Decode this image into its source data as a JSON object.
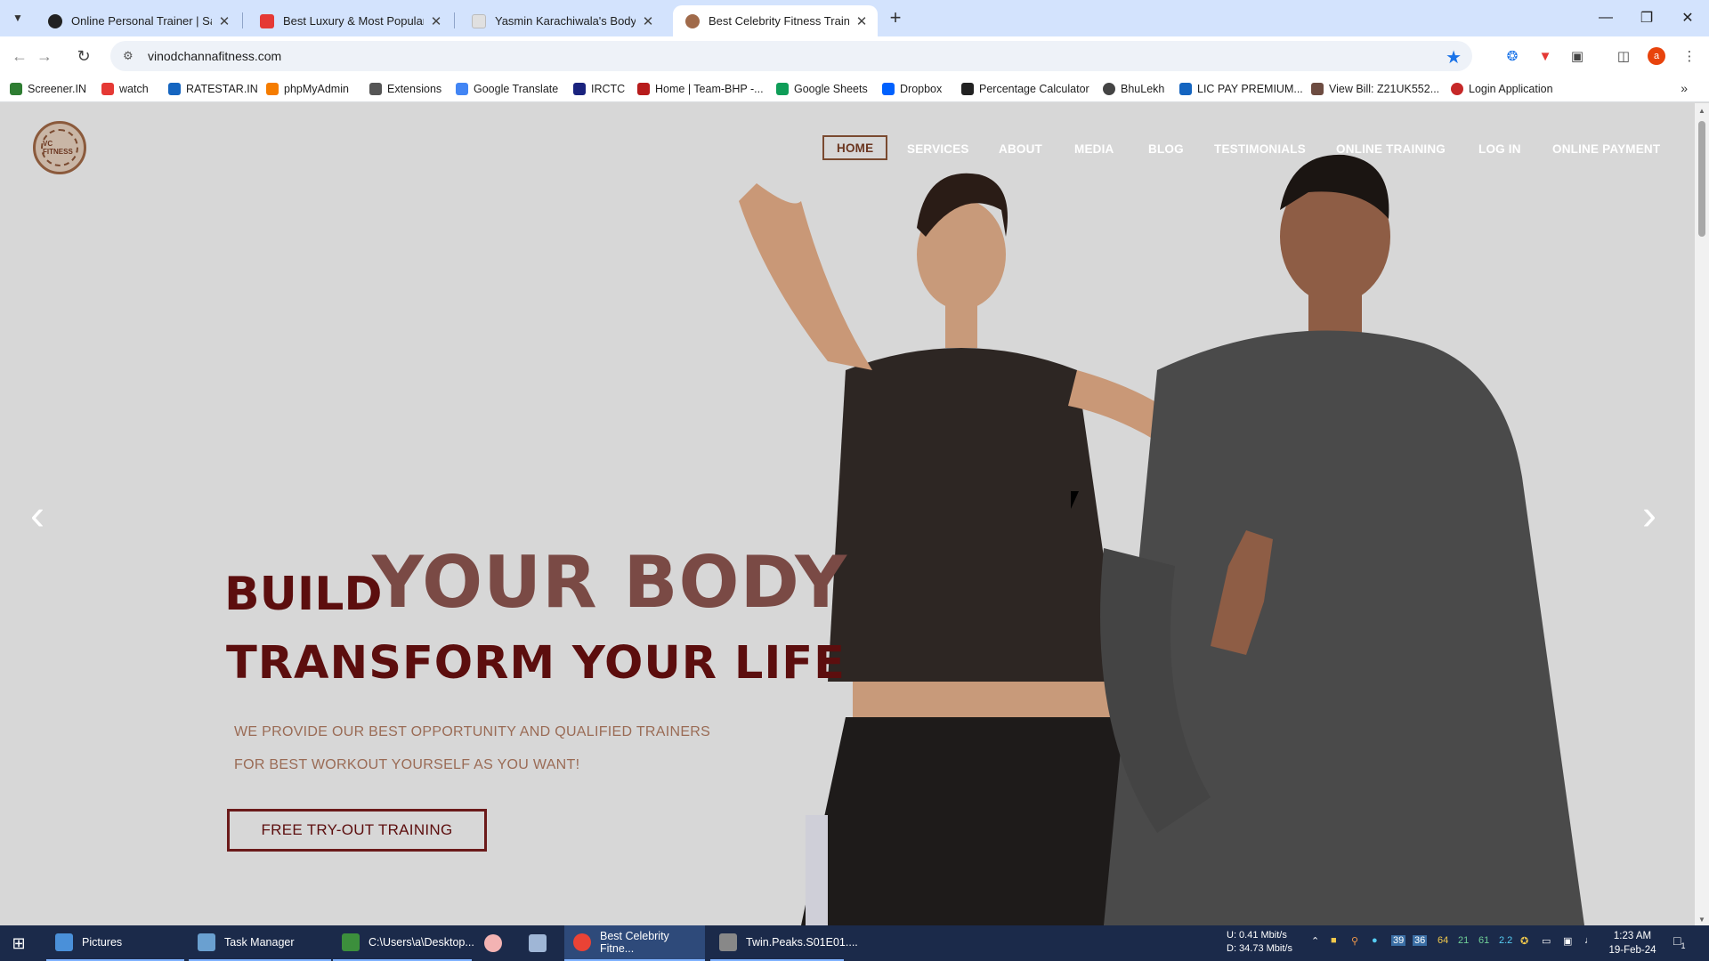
{
  "browser": {
    "tabs": [
      {
        "title": "Online Personal Trainer | Sarah",
        "favicon_color": "#222222",
        "active": false
      },
      {
        "title": "Best Luxury & Most Popular Gy",
        "favicon_color": "#e53935",
        "active": false
      },
      {
        "title": "Yasmin Karachiwala's Bodyimag",
        "favicon_color": "#bdbdbd",
        "active": false
      },
      {
        "title": "Best Celebrity Fitness Trainer in",
        "favicon_color": "#a06a4a",
        "active": true
      }
    ],
    "url": "vinodchannafitness.com",
    "profile_initial": "a",
    "bookmarks": [
      {
        "label": "Screener.IN",
        "icon_color": "#2e7d32"
      },
      {
        "label": "watch",
        "icon_color": "#e53935"
      },
      {
        "label": "RATESTAR.IN",
        "icon_color": "#1565c0"
      },
      {
        "label": "phpMyAdmin",
        "icon_color": "#f57c00"
      },
      {
        "label": "Extensions",
        "icon_color": "#555555"
      },
      {
        "label": "Google Translate",
        "icon_color": "#4285f4"
      },
      {
        "label": "IRCTC",
        "icon_color": "#1a237e"
      },
      {
        "label": "Home | Team-BHP -...",
        "icon_color": "#b71c1c"
      },
      {
        "label": "Google Sheets",
        "icon_color": "#0f9d58"
      },
      {
        "label": "Dropbox",
        "icon_color": "#0061fe"
      },
      {
        "label": "Percentage Calculator",
        "icon_color": "#222222"
      },
      {
        "label": "BhuLekh",
        "icon_color": "#444444"
      },
      {
        "label": "LIC PAY PREMIUM...",
        "icon_color": "#1565c0"
      },
      {
        "label": "View Bill: Z21UK552...",
        "icon_color": "#6d4c41"
      },
      {
        "label": "Login Application",
        "icon_color": "#c62828"
      }
    ]
  },
  "site": {
    "logo_text": "VC FITNESS",
    "nav": [
      "HOME",
      "SERVICES",
      "ABOUT",
      "MEDIA",
      "BLOG",
      "TESTIMONIALS",
      "ONLINE TRAINING",
      "LOG IN",
      "ONLINE PAYMENT"
    ],
    "hero": {
      "build": "BUILD",
      "your_body": "YOUR BODY",
      "transform": "TRANSFORM YOUR LIFE",
      "sub_line1": "WE PROVIDE OUR BEST OPPORTUNITY AND QUALIFIED TRAINERS",
      "sub_line2": "FOR BEST WORKOUT YOURSELF AS YOU WANT!",
      "cta": "FREE TRY-OUT TRAINING"
    },
    "accent": "#5c0e0e"
  },
  "taskbar": {
    "items": [
      {
        "label": "Pictures",
        "icon_color": "#4a90d9"
      },
      {
        "label": "Task Manager",
        "icon_color": "#6aa0d0"
      },
      {
        "label": "C:\\Users\\a\\Desktop...",
        "icon_color": "#3c8f3c"
      },
      {
        "label": "Best Celebrity Fitne...",
        "icon_color": "#ea4335"
      },
      {
        "label": "Twin.Peaks.S01E01....",
        "icon_color": "#888888"
      }
    ],
    "net_up": "U:    0.41 Mbit/s",
    "net_down": "D:  34.73 Mbit/s",
    "tray_numbers": [
      "39",
      "36",
      "64",
      "21",
      "61",
      "2.2"
    ],
    "time": "1:23 AM",
    "date": "19-Feb-24",
    "notification_count": "1"
  }
}
